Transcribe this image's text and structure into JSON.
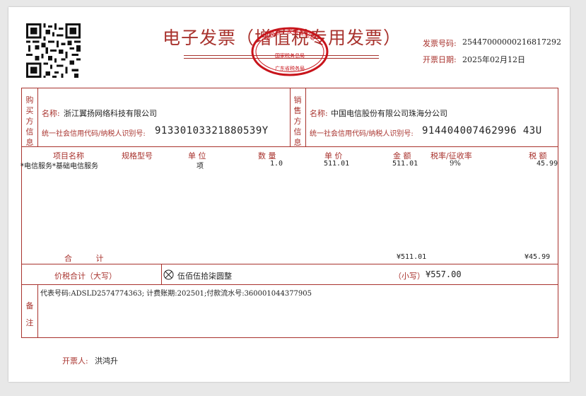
{
  "header": {
    "title": "电子发票（增值税专用发票）",
    "invoice_no_label": "发票号码:",
    "invoice_no": "25447000000216817292",
    "date_label": "开票日期:",
    "date": "2025年02月12日"
  },
  "seal": {
    "top_text": "全国统一发票监制章",
    "middle_text": "国家税务总局",
    "bottom_text": "广东省税务局"
  },
  "buyer": {
    "section_label": "购买方信息",
    "name_label": "名称:",
    "name": "浙江翼扬网络科技有限公司",
    "tax_id_label": "统一社会信用代码/纳税人识别号:",
    "tax_id": "91330103321880539Y"
  },
  "seller": {
    "section_label": "销售方信息",
    "name_label": "名称:",
    "name": "中国电信股份有限公司珠海分公司",
    "tax_id_label": "统一社会信用代码/纳税人识别号:",
    "tax_id": "914404007462996 43U"
  },
  "items": {
    "headers": {
      "name": "项目名称",
      "spec": "规格型号",
      "unit": "单 位",
      "qty": "数 量",
      "price": "单 价",
      "amount": "金 额",
      "rate": "税率/征收率",
      "tax": "税 额"
    },
    "rows": [
      {
        "name": "*电信服务*基础电信服务",
        "spec": "",
        "unit": "项",
        "qty": "1.0",
        "price": "511.01",
        "amount": "511.01",
        "rate": "9%",
        "tax": "45.99"
      }
    ],
    "total_label": "合  计",
    "total_amount": "¥511.01",
    "total_tax": "¥45.99"
  },
  "sum": {
    "label": "价税合计（大写）",
    "words": "伍佰伍拾柒圆整",
    "small_label": "（小写）",
    "small_value": "¥557.00"
  },
  "remarks": {
    "label": "备注",
    "text": "代表号码:ADSLD2574774363; 计费账期:202501;付款流水号:360001044377905"
  },
  "footer": {
    "issuer_label": "开票人:",
    "issuer": "洪鸿升"
  },
  "colors": {
    "accent": "#a8322d",
    "page": "#ffffff",
    "background": "#e8e8e8"
  }
}
